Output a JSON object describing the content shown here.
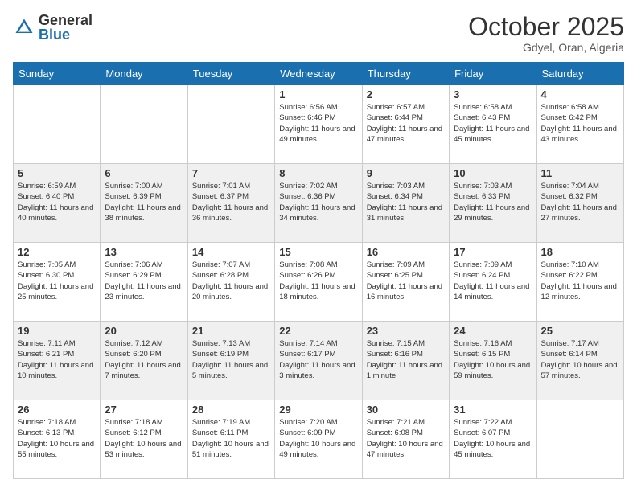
{
  "header": {
    "logo_general": "General",
    "logo_blue": "Blue",
    "month": "October 2025",
    "location": "Gdyel, Oran, Algeria"
  },
  "weekdays": [
    "Sunday",
    "Monday",
    "Tuesday",
    "Wednesday",
    "Thursday",
    "Friday",
    "Saturday"
  ],
  "weeks": [
    [
      {
        "day": "",
        "info": ""
      },
      {
        "day": "",
        "info": ""
      },
      {
        "day": "",
        "info": ""
      },
      {
        "day": "1",
        "info": "Sunrise: 6:56 AM\nSunset: 6:46 PM\nDaylight: 11 hours and 49 minutes."
      },
      {
        "day": "2",
        "info": "Sunrise: 6:57 AM\nSunset: 6:44 PM\nDaylight: 11 hours and 47 minutes."
      },
      {
        "day": "3",
        "info": "Sunrise: 6:58 AM\nSunset: 6:43 PM\nDaylight: 11 hours and 45 minutes."
      },
      {
        "day": "4",
        "info": "Sunrise: 6:58 AM\nSunset: 6:42 PM\nDaylight: 11 hours and 43 minutes."
      }
    ],
    [
      {
        "day": "5",
        "info": "Sunrise: 6:59 AM\nSunset: 6:40 PM\nDaylight: 11 hours and 40 minutes."
      },
      {
        "day": "6",
        "info": "Sunrise: 7:00 AM\nSunset: 6:39 PM\nDaylight: 11 hours and 38 minutes."
      },
      {
        "day": "7",
        "info": "Sunrise: 7:01 AM\nSunset: 6:37 PM\nDaylight: 11 hours and 36 minutes."
      },
      {
        "day": "8",
        "info": "Sunrise: 7:02 AM\nSunset: 6:36 PM\nDaylight: 11 hours and 34 minutes."
      },
      {
        "day": "9",
        "info": "Sunrise: 7:03 AM\nSunset: 6:34 PM\nDaylight: 11 hours and 31 minutes."
      },
      {
        "day": "10",
        "info": "Sunrise: 7:03 AM\nSunset: 6:33 PM\nDaylight: 11 hours and 29 minutes."
      },
      {
        "day": "11",
        "info": "Sunrise: 7:04 AM\nSunset: 6:32 PM\nDaylight: 11 hours and 27 minutes."
      }
    ],
    [
      {
        "day": "12",
        "info": "Sunrise: 7:05 AM\nSunset: 6:30 PM\nDaylight: 11 hours and 25 minutes."
      },
      {
        "day": "13",
        "info": "Sunrise: 7:06 AM\nSunset: 6:29 PM\nDaylight: 11 hours and 23 minutes."
      },
      {
        "day": "14",
        "info": "Sunrise: 7:07 AM\nSunset: 6:28 PM\nDaylight: 11 hours and 20 minutes."
      },
      {
        "day": "15",
        "info": "Sunrise: 7:08 AM\nSunset: 6:26 PM\nDaylight: 11 hours and 18 minutes."
      },
      {
        "day": "16",
        "info": "Sunrise: 7:09 AM\nSunset: 6:25 PM\nDaylight: 11 hours and 16 minutes."
      },
      {
        "day": "17",
        "info": "Sunrise: 7:09 AM\nSunset: 6:24 PM\nDaylight: 11 hours and 14 minutes."
      },
      {
        "day": "18",
        "info": "Sunrise: 7:10 AM\nSunset: 6:22 PM\nDaylight: 11 hours and 12 minutes."
      }
    ],
    [
      {
        "day": "19",
        "info": "Sunrise: 7:11 AM\nSunset: 6:21 PM\nDaylight: 11 hours and 10 minutes."
      },
      {
        "day": "20",
        "info": "Sunrise: 7:12 AM\nSunset: 6:20 PM\nDaylight: 11 hours and 7 minutes."
      },
      {
        "day": "21",
        "info": "Sunrise: 7:13 AM\nSunset: 6:19 PM\nDaylight: 11 hours and 5 minutes."
      },
      {
        "day": "22",
        "info": "Sunrise: 7:14 AM\nSunset: 6:17 PM\nDaylight: 11 hours and 3 minutes."
      },
      {
        "day": "23",
        "info": "Sunrise: 7:15 AM\nSunset: 6:16 PM\nDaylight: 11 hours and 1 minute."
      },
      {
        "day": "24",
        "info": "Sunrise: 7:16 AM\nSunset: 6:15 PM\nDaylight: 10 hours and 59 minutes."
      },
      {
        "day": "25",
        "info": "Sunrise: 7:17 AM\nSunset: 6:14 PM\nDaylight: 10 hours and 57 minutes."
      }
    ],
    [
      {
        "day": "26",
        "info": "Sunrise: 7:18 AM\nSunset: 6:13 PM\nDaylight: 10 hours and 55 minutes."
      },
      {
        "day": "27",
        "info": "Sunrise: 7:18 AM\nSunset: 6:12 PM\nDaylight: 10 hours and 53 minutes."
      },
      {
        "day": "28",
        "info": "Sunrise: 7:19 AM\nSunset: 6:11 PM\nDaylight: 10 hours and 51 minutes."
      },
      {
        "day": "29",
        "info": "Sunrise: 7:20 AM\nSunset: 6:09 PM\nDaylight: 10 hours and 49 minutes."
      },
      {
        "day": "30",
        "info": "Sunrise: 7:21 AM\nSunset: 6:08 PM\nDaylight: 10 hours and 47 minutes."
      },
      {
        "day": "31",
        "info": "Sunrise: 7:22 AM\nSunset: 6:07 PM\nDaylight: 10 hours and 45 minutes."
      },
      {
        "day": "",
        "info": ""
      }
    ]
  ]
}
